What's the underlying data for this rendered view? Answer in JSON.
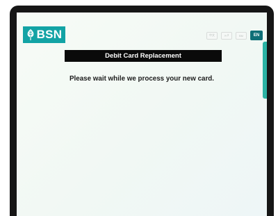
{
  "brand": {
    "name": "BSN",
    "logo_icon": "tree-leaf-icon",
    "color": "#13a3a5"
  },
  "languages": {
    "options": [
      "中文",
      "தமி",
      "BM",
      "EN"
    ],
    "selected": "EN"
  },
  "page": {
    "title": "Debit Card Replacement",
    "message": "Please wait while we process your new card."
  },
  "colors": {
    "title_bar": "#0a0a0a",
    "accent": "#2bb3a4",
    "device_frame": "#161616"
  }
}
